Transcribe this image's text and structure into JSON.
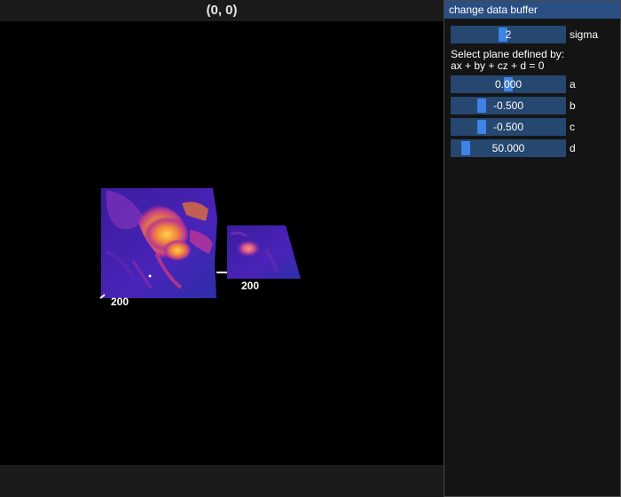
{
  "canvas": {
    "title": "(0, 0)",
    "scale_labels": [
      "200",
      "200"
    ]
  },
  "panel": {
    "title": "change data buffer",
    "sigma": {
      "value": "2",
      "label": "sigma",
      "fill_fraction": 0.45
    },
    "instruction_line1": "Select plane defined by:",
    "instruction_line2": "ax + by + cz + d = 0",
    "sliders": [
      {
        "value": "0.000",
        "label": "a",
        "fill_fraction": 0.5
      },
      {
        "value": "-0.500",
        "label": "b",
        "fill_fraction": 0.25
      },
      {
        "value": "-0.500",
        "label": "c",
        "fill_fraction": 0.25
      },
      {
        "value": "50.000",
        "label": "d",
        "fill_fraction": 0.1
      }
    ]
  },
  "colors": {
    "panel_header": "#2a4f82",
    "slider_bg": "#254770",
    "slider_grab": "#3d84e6",
    "viewport_bg": "#000000"
  }
}
